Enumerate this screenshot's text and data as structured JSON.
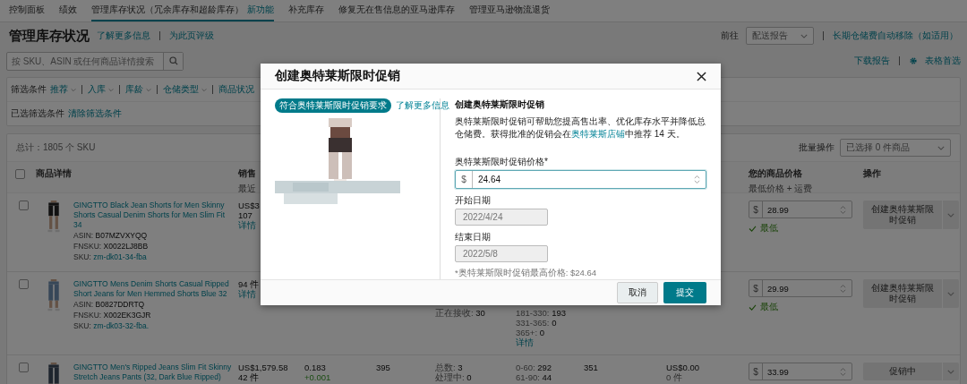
{
  "nav_tabs": [
    {
      "label": "控制面板",
      "selected": false
    },
    {
      "label": "绩效",
      "selected": false
    },
    {
      "label": "管理库存状况（冗余库存和超龄库存）",
      "new_label": "新功能",
      "selected": true
    },
    {
      "label": "补充库存",
      "selected": false
    },
    {
      "label": "修复无在售信息的亚马逊库存",
      "selected": false
    },
    {
      "label": "管理亚马逊物流退货",
      "selected": false
    }
  ],
  "header": {
    "title": "管理库存状况",
    "links": [
      "了解更多信息",
      "为此页评级"
    ],
    "goto_label": "前往",
    "goto_select": "配送报告",
    "removal_link": "长期仓储费自动移除（如适用）"
  },
  "search": {
    "placeholder": "按 SKU、ASIN 或任何商品详情搜索"
  },
  "tools": {
    "download_link": "下载报告",
    "preferences_link": "表格首选"
  },
  "filters": {
    "label": "筛选条件",
    "dropdowns": [
      "推荐",
      "入库",
      "库龄",
      "仓储类型"
    ],
    "last_item": "商品状况",
    "selected_label": "已选筛选条件",
    "clear_link": "清除筛选条件"
  },
  "table": {
    "total": "总计：1805 个 SKU",
    "bulk_label": "批量操作",
    "bulk_select": "已选择 0 件商品",
    "header_checked": false,
    "columns": [
      {
        "label": "商品详情"
      },
      {
        "label": "销售",
        "sublabel": "最近"
      },
      {
        "label": "您的商品价格",
        "sublabel": "最低价格 + 运费"
      },
      {
        "label": "操作"
      }
    ],
    "rows": [
      {
        "checked": false,
        "title": "GINGTTO Black Jean Shorts for Men Skinny Shorts Casual Denim Shorts for Men Slim Fit 34",
        "ids": [
          {
            "label": "ASIN:",
            "value": "B07MZVXYQQ",
            "kind": "pair"
          },
          {
            "label": "FNSKU:",
            "value": "X0022LJ8BB",
            "kind": "pair"
          },
          {
            "label": "SKU:",
            "value": "zm-dk01-34-fba",
            "kind": "link-pair"
          }
        ],
        "cells": {
          "sales": [
            {
              "kind": "plain",
              "text": "US$3"
            },
            {
              "kind": "plain",
              "text": "107"
            },
            {
              "kind": "link",
              "text": "详情"
            }
          ]
        },
        "price": {
          "currency": "$",
          "value": "28.99",
          "note": "最低"
        },
        "action": "创建奥特莱斯限时促销"
      },
      {
        "checked": false,
        "title": "GINGTTO Mens Denim Shorts Casual Ripped Short Jeans for Men Hemmed Shorts Blue 32",
        "ids": [
          {
            "label": "ASIN:",
            "value": "B0827DDRTQ",
            "kind": "pair"
          },
          {
            "label": "FNSKU:",
            "value": "X002EK3GJR",
            "kind": "pair"
          },
          {
            "label": "SKU:",
            "value": "zm-dk03-32-fba.",
            "kind": "link-pair"
          }
        ],
        "cells": {
          "sales": [
            {
              "kind": "plain",
              "text": "94 件"
            },
            {
              "kind": "link",
              "text": "详情"
            }
          ],
          "column_5": [
            {
              "kind": "pair",
              "label": "正在接收:",
              "value": "30"
            }
          ],
          "column_6": [
            {
              "kind": "pair",
              "label": "181-330:",
              "value": "193"
            },
            {
              "kind": "pair",
              "label": "331-365:",
              "value": "0"
            },
            {
              "kind": "pair",
              "label": "365+:",
              "value": "0"
            },
            {
              "kind": "link",
              "text": "详情"
            }
          ]
        },
        "price": {
          "currency": "$",
          "value": "29.99",
          "note": "最低"
        },
        "action": "创建奥特莱斯限时促销"
      },
      {
        "checked": false,
        "title": "GINGTTO Men's Ripped Jeans Slim Fit Skinny Stretch Jeans Pants (32, Dark Blue Ripped)",
        "ids": [],
        "cells": {
          "sales": [
            {
              "kind": "plain",
              "text": "US$1,579.58"
            },
            {
              "kind": "plain",
              "text": "42 件"
            }
          ],
          "column_3": [
            {
              "kind": "plain",
              "text": "0.183"
            },
            {
              "kind": "delta",
              "text": "+0.001"
            }
          ],
          "column_4": [
            {
              "kind": "plain",
              "text": "395"
            }
          ],
          "column_5": [
            {
              "kind": "pair",
              "label": "总数:",
              "value": "3"
            },
            {
              "kind": "pair",
              "label": "处理中:",
              "value": "0"
            }
          ],
          "column_6": [
            {
              "kind": "pair",
              "label": "0-60:",
              "value": "292"
            },
            {
              "kind": "pair",
              "label": "61-90:",
              "value": "44"
            }
          ],
          "column_7": [
            {
              "kind": "plain",
              "text": "351"
            }
          ],
          "column_8": [
            {
              "kind": "plain",
              "text": "US$0.00"
            },
            {
              "kind": "muted",
              "text": "0 件"
            }
          ]
        },
        "price": {
          "currency": "$",
          "value": "33.99"
        },
        "action": "促销中"
      }
    ]
  },
  "modal": {
    "title": "创建奥特莱斯限时促销",
    "badge": "符合奥特莱斯限时促销要求",
    "learn_link": "了解更多信息",
    "heading": "创建奥特莱斯限时促销",
    "text_before": "奥特莱斯限时促销可帮助您提高售出率、优化库存水平并降低总仓储费。获得批准的促销会在",
    "text_link": "奥特莱斯店铺",
    "text_after": "中推荐 14 天。",
    "price_label": "奥特莱斯限时促销价格*",
    "currency": "$",
    "price_value": "24.64",
    "dates": [
      {
        "label": "开始日期",
        "value": "2022/4/24",
        "disabled": true
      },
      {
        "label": "结束日期",
        "value": "2022/5/8",
        "disabled": true
      }
    ],
    "note": "*奥特莱斯限时促销最高价格: $24.64",
    "cancel": "取消",
    "submit": "提交"
  }
}
